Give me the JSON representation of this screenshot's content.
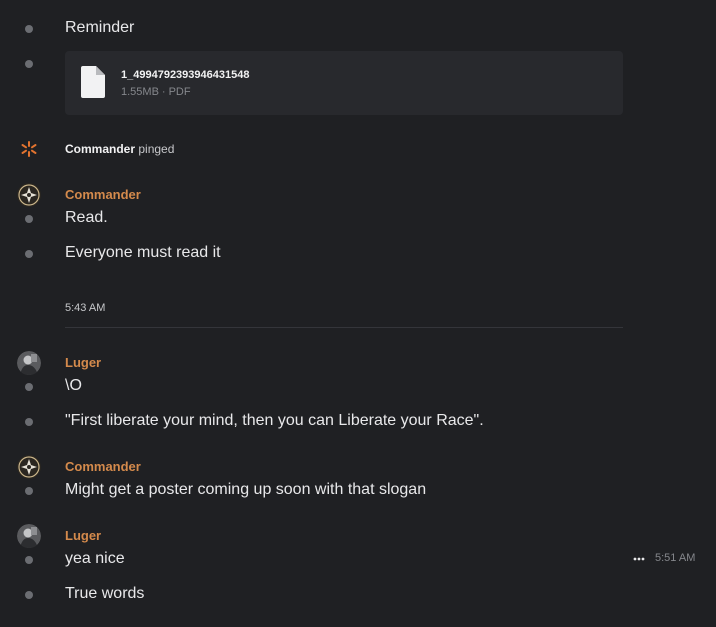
{
  "messages": {
    "reminder": "Reminder",
    "file": {
      "name": "1_4994792393946431548",
      "size": "1.55MB",
      "separator": "·",
      "type": "PDF"
    },
    "ping": {
      "who": "Commander",
      "action": "pinged"
    },
    "commander_1": {
      "author": "Commander",
      "line1": "Read.",
      "line2": "Everyone must read it"
    },
    "divider_time": "5:43 AM",
    "luger_1": {
      "author": "Luger",
      "line1": "\\O",
      "line2": "\"First liberate your mind, then you can Liberate your Race\"."
    },
    "commander_2": {
      "author": "Commander",
      "line1": "Might get a poster coming up soon with that slogan"
    },
    "luger_2": {
      "author": "Luger",
      "line1": "yea nice",
      "line2": "True words"
    },
    "hover": {
      "time": "5:51 AM"
    }
  },
  "colors": {
    "background": "#1f2023",
    "author": "#d48a4c",
    "ping_icon": "#e2732f",
    "file_card": "#28292d"
  }
}
